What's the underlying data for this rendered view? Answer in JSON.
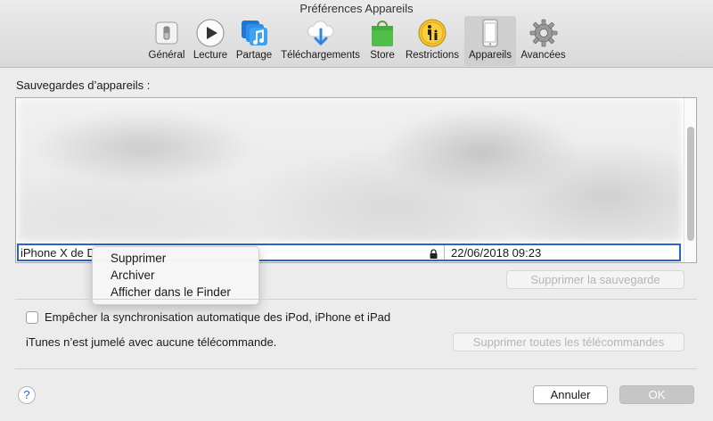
{
  "window": {
    "title": "Préférences Appareils"
  },
  "toolbar": {
    "items": [
      {
        "label": "Général",
        "icon": "switch-icon"
      },
      {
        "label": "Lecture",
        "icon": "play-icon"
      },
      {
        "label": "Partage",
        "icon": "music-note-icon"
      },
      {
        "label": "Téléchargements",
        "icon": "cloud-download-icon"
      },
      {
        "label": "Store",
        "icon": "shopping-bag-icon"
      },
      {
        "label": "Restrictions",
        "icon": "parental-icon"
      },
      {
        "label": "Appareils",
        "icon": "phone-icon",
        "selected": true
      },
      {
        "label": "Avancées",
        "icon": "gear-icon"
      }
    ]
  },
  "backups": {
    "label": "Sauvegardes d’appareils :",
    "selected_row": {
      "name": "iPhone X de D",
      "date": "22/06/2018 09:23",
      "locked": true
    }
  },
  "context_menu": {
    "items": [
      "Supprimer",
      "Archiver",
      "Afficher dans le Finder"
    ]
  },
  "buttons": {
    "delete_backup": "Supprimer la sauvegarde",
    "delete_remotes": "Supprimer toutes les télécommandes",
    "cancel": "Annuler",
    "ok": "OK",
    "help": "?"
  },
  "options": {
    "prevent_sync_label": "Empêcher la synchronisation automatique des iPod, iPhone et iPad",
    "prevent_sync_checked": false,
    "remote_status": "iTunes n’est jumelé avec aucune télécommande."
  },
  "colors": {
    "selection": "#2a64c4",
    "toolbar_selected": "#cfcfcf"
  }
}
